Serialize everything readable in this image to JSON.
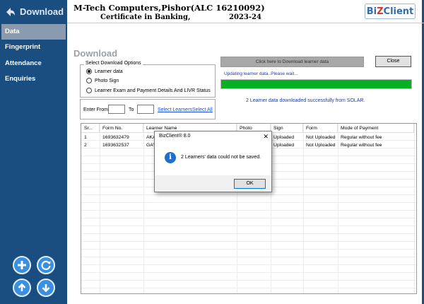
{
  "sidebar": {
    "header": {
      "title": "Download",
      "icon": "back-arrow-icon"
    },
    "items": [
      {
        "label": "Data",
        "active": true
      },
      {
        "label": "Fingerprint",
        "active": false
      },
      {
        "label": "Attendance",
        "active": false
      },
      {
        "label": "Enquiries",
        "active": false
      }
    ],
    "actions": [
      {
        "icon": "plus-icon"
      },
      {
        "icon": "refresh-icon"
      },
      {
        "icon": "arrow-up-icon"
      },
      {
        "icon": "arrow-down-icon"
      }
    ],
    "colors": {
      "background": "#1a4d80",
      "active": "#8a9bb0",
      "round_button": "#3a8fe0"
    }
  },
  "header": {
    "title": "M-Tech Computers,Pishor(ALC 16210092)",
    "course": "Certificate in Banking,",
    "year": "2023-24",
    "logo": {
      "part1": "Bi",
      "part2": "Z",
      "part3": "Client"
    }
  },
  "main": {
    "section_title": "Download",
    "options": {
      "legend": "Select Download Options",
      "items": [
        {
          "label": "Learner data",
          "selected": true
        },
        {
          "label": "Photo Sign",
          "selected": false
        },
        {
          "label": "Learner Exam and Payment Details  And LIVR Status",
          "selected": false
        }
      ]
    },
    "filter": {
      "from_label": "Enter From",
      "from_value": "",
      "to_label": "To",
      "to_value": "",
      "select_learners": "Select Learners",
      "select_all": "Select All"
    },
    "download_button": "Click here to Download learner data",
    "close_button": "Close",
    "status": "Updating learner data..Please wait...",
    "progress": 1.0,
    "progress_color": "#06b025",
    "success_message": "2 Learner data downloaded successfully from SOLAR."
  },
  "table": {
    "columns": [
      "Sr...",
      "Form No.",
      "Learner Name",
      "Photo",
      "Sign",
      "Form",
      "Mode of Payment"
    ],
    "rows": [
      [
        "1",
        "1693632479",
        "AKA",
        "",
        "Uploaded",
        "Not Uploaded",
        "Regular without fee"
      ],
      [
        "2",
        "1693632537",
        "GAY",
        "",
        "Uploaded",
        "Not Uploaded",
        "Regular without fee"
      ]
    ]
  },
  "dialog": {
    "title": "BizClient® 8.0",
    "message": "2 Learners' data could not be saved.",
    "ok_label": "OK",
    "icon": "info-icon"
  }
}
